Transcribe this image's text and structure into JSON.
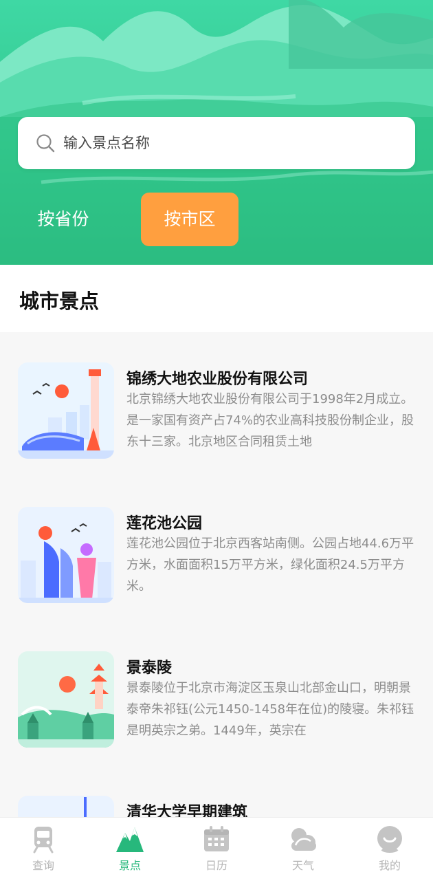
{
  "search": {
    "placeholder": "输入景点名称",
    "icon": "search-icon"
  },
  "filter": {
    "by_province": "按省份",
    "by_city": "按市区",
    "active": "by_city",
    "active_color": "#ff9f3f"
  },
  "section": {
    "title": "城市景点"
  },
  "spots": [
    {
      "name": "锦绣大地农业股份有限公司",
      "desc": "北京锦绣大地农业股份有限公司于1998年2月成立。是一家国有资产占74%的农业高科技股份制企业，股东十三家。北京地区合同租赁土地"
    },
    {
      "name": "莲花池公园",
      "desc": "莲花池公园位于北京西客站南侧。公园占地44.6万平方米，水面面积15万平方米，绿化面积24.5万平方米。"
    },
    {
      "name": "景泰陵",
      "desc": "景泰陵位于北京市海淀区玉泉山北部金山口，明朝景泰帝朱祁钰(公元1450-1458年在位)的陵寝。朱祁钰是明英宗之弟。1449年，英宗在"
    },
    {
      "name": "清华大学早期建筑",
      "desc": ""
    }
  ],
  "tabs": [
    {
      "label": "查询",
      "icon": "train-icon"
    },
    {
      "label": "景点",
      "icon": "mountain-icon"
    },
    {
      "label": "日历",
      "icon": "calendar-icon"
    },
    {
      "label": "天气",
      "icon": "cloud-icon"
    },
    {
      "label": "我的",
      "icon": "user-face-icon"
    }
  ],
  "colors": {
    "brand_green": "#27b87c",
    "accent_orange": "#ff9f3f"
  }
}
